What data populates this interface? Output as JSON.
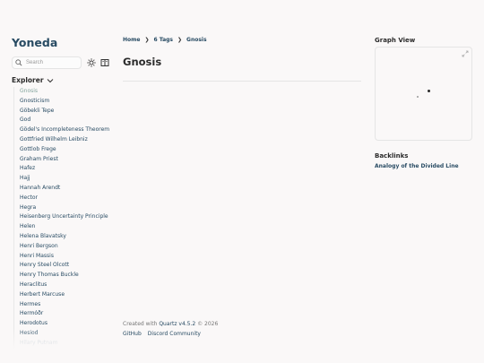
{
  "site": {
    "title": "Yoneda"
  },
  "search": {
    "placeholder": "Search"
  },
  "explorer": {
    "label": "Explorer",
    "items": [
      "Gnosis",
      "Gnosticism",
      "Göbekli Tepe",
      "God",
      "Gödel's Incompleteness Theorem",
      "Gottfried Wilhelm Leibniz",
      "Gottlob Frege",
      "Graham Priest",
      "Hafez",
      "Hajj",
      "Hannah Arendt",
      "Hector",
      "Hegra",
      "Heisenberg Uncertainty Principle",
      "Helen",
      "Helena Blavatsky",
      "Henri Bergson",
      "Henri Massis",
      "Henry Steel Olcott",
      "Henry Thomas Buckle",
      "Heraclitus",
      "Herbert Marcuse",
      "Hermes",
      "Hermóðr",
      "Herodotus",
      "Hesiod",
      "Hilary Putnam"
    ]
  },
  "breadcrumb": {
    "home": "Home",
    "tags": "6 Tags",
    "current": "Gnosis",
    "separator": "❯"
  },
  "page": {
    "title": "Gnosis"
  },
  "footer": {
    "created_prefix": "Created with",
    "quartz": "Quartz v4.5.2",
    "year": "© 2026",
    "links": [
      "GitHub",
      "Discord Community"
    ]
  },
  "graph": {
    "title": "Graph View"
  },
  "backlinks": {
    "title": "Backlinks",
    "items": [
      "Analogy of the Divided Line"
    ]
  },
  "colors": {
    "primary": "#284b63",
    "secondary": "#84a59d",
    "background": "#faf8f8",
    "text": "#2b2b2b"
  },
  "icons": {
    "search": "search-icon",
    "theme": "sun-icon",
    "reader": "book-icon",
    "explorer_toggle": "chevron-down-icon",
    "graph_expand": "expand-icon"
  }
}
